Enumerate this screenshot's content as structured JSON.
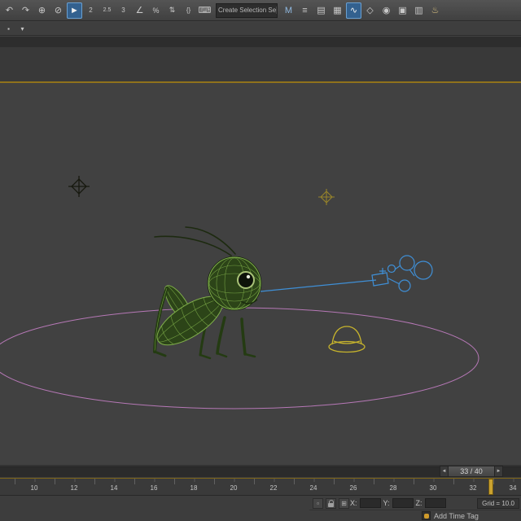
{
  "colors": {
    "viewport_bg": "#414141",
    "viewport_border": "#8f721c",
    "spline": "#b678b6",
    "wire": "#7fae4a",
    "body_fill": "#2c4418",
    "body_dark": "#1b2c0f",
    "outline": "#16230d",
    "rig": "#3f8fd6",
    "hat": "#c7b42c",
    "helper_dark": "#17190f",
    "helper_yellow": "#96832a",
    "frame_marker": "#caa22f",
    "toolbar_active": "#33618f"
  },
  "toolbar": {
    "icons_left": [
      {
        "name": "undo-icon",
        "glyph": "↶"
      },
      {
        "name": "redo-icon",
        "glyph": "↷"
      },
      {
        "name": "select-link-icon",
        "glyph": "⊕"
      },
      {
        "name": "unlink-selection-icon",
        "glyph": "⊘"
      },
      {
        "name": "select-object-icon",
        "glyph": "►",
        "active": true
      },
      {
        "name": "snap-2d-icon",
        "glyph": "2",
        "size": 8
      },
      {
        "name": "snap-25d-icon",
        "glyph": "2.5",
        "size": 7
      },
      {
        "name": "snap-3d-icon",
        "glyph": "3",
        "size": 8
      },
      {
        "name": "angle-snap-icon",
        "glyph": "∠"
      },
      {
        "name": "percent-snap-icon",
        "glyph": "%",
        "size": 9
      },
      {
        "name": "spinner-snap-icon",
        "glyph": "⇅",
        "size": 9
      },
      {
        "name": "named-selection-sets-icon",
        "glyph": "{}",
        "size": 8
      },
      {
        "name": "keyboard-override-icon",
        "glyph": "⌨"
      }
    ],
    "selection_set_value": "Create Selection Se",
    "dropdown_arrow": "▾",
    "icons_right": [
      {
        "name": "mirror-icon",
        "glyph": "M",
        "color": "#8fb8e0"
      },
      {
        "name": "align-icon",
        "glyph": "≡"
      },
      {
        "name": "layer-manager-icon",
        "glyph": "▤"
      },
      {
        "name": "graphite-modeling-icon",
        "glyph": "▦"
      },
      {
        "name": "curve-editor-icon",
        "glyph": "∿",
        "active": true
      },
      {
        "name": "schematic-view-icon",
        "glyph": "◇"
      },
      {
        "name": "material-editor-icon",
        "glyph": "◉"
      },
      {
        "name": "render-setup-icon",
        "glyph": "▣"
      },
      {
        "name": "rendered-frame-icon",
        "glyph": "▥"
      },
      {
        "name": "render-production-icon",
        "glyph": "♨",
        "color": "#d8c080"
      }
    ]
  },
  "toolbar2": {
    "icons": [
      {
        "name": "mini-toolbar-icon",
        "glyph": "▪"
      },
      {
        "name": "mini-dropdown-icon",
        "glyph": "▾"
      }
    ]
  },
  "timeline": {
    "frame_display": "33 / 40",
    "prev_arrow": "◄",
    "next_arrow": "►",
    "ticks": [
      "10",
      "12",
      "14",
      "16",
      "18",
      "20",
      "22",
      "24",
      "26",
      "28",
      "30",
      "32",
      "34"
    ]
  },
  "status_bar": {
    "icon1": "▫",
    "icon3": "⊞",
    "x_label": "X:",
    "y_label": "Y:",
    "z_label": "Z:",
    "x_value": "",
    "y_value": "",
    "z_value": "",
    "grid_label": "Grid = 10.0",
    "add_time_tag": "Add Time Tag"
  }
}
